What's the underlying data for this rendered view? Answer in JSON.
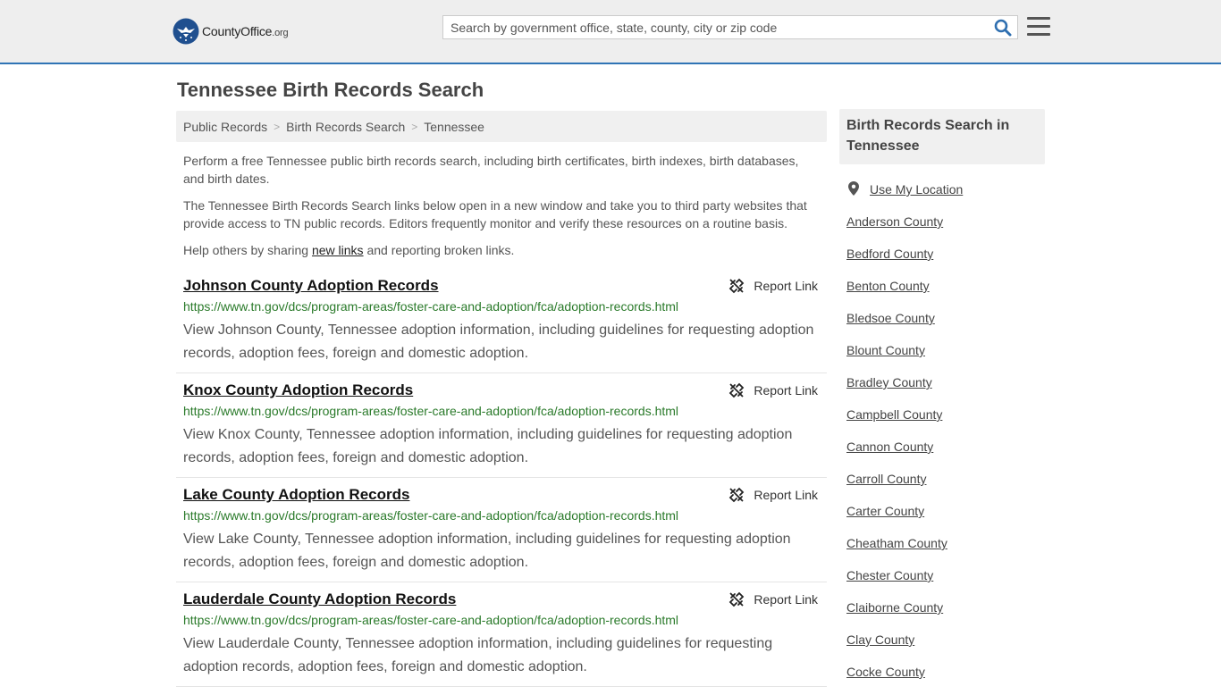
{
  "brand": {
    "name": "CountyOffice",
    "tld": ".org"
  },
  "search": {
    "placeholder": "Search by government office, state, county, city or zip code",
    "value": ""
  },
  "page": {
    "title": "Tennessee Birth Records Search"
  },
  "breadcrumb": {
    "items": [
      "Public Records",
      "Birth Records Search",
      "Tennessee"
    ]
  },
  "intro": {
    "p1": "Perform a free Tennessee public birth records search, including birth certificates, birth indexes, birth databases, and birth dates.",
    "p2": "The Tennessee Birth Records Search links below open in a new window and take you to third party websites that provide access to TN public records. Editors frequently monitor and verify these resources on a routine basis.",
    "p3_before": "Help others by sharing ",
    "p3_link": "new links",
    "p3_after": " and reporting broken links."
  },
  "report_label": "Report Link",
  "results": [
    {
      "title": "Johnson County Adoption Records",
      "url": "https://www.tn.gov/dcs/program-areas/foster-care-and-adoption/fca/adoption-records.html",
      "desc": "View Johnson County, Tennessee adoption information, including guidelines for requesting adoption records, adoption fees, foreign and domestic adoption."
    },
    {
      "title": "Knox County Adoption Records",
      "url": "https://www.tn.gov/dcs/program-areas/foster-care-and-adoption/fca/adoption-records.html",
      "desc": "View Knox County, Tennessee adoption information, including guidelines for requesting adoption records, adoption fees, foreign and domestic adoption."
    },
    {
      "title": "Lake County Adoption Records",
      "url": "https://www.tn.gov/dcs/program-areas/foster-care-and-adoption/fca/adoption-records.html",
      "desc": "View Lake County, Tennessee adoption information, including guidelines for requesting adoption records, adoption fees, foreign and domestic adoption."
    },
    {
      "title": "Lauderdale County Adoption Records",
      "url": "https://www.tn.gov/dcs/program-areas/foster-care-and-adoption/fca/adoption-records.html",
      "desc": "View Lauderdale County, Tennessee adoption information, including guidelines for requesting adoption records, adoption fees, foreign and domestic adoption."
    }
  ],
  "sidebar": {
    "heading": "Birth Records Search in Tennessee",
    "location_label": "Use My Location",
    "counties": [
      "Anderson County",
      "Bedford County",
      "Benton County",
      "Bledsoe County",
      "Blount County",
      "Bradley County",
      "Campbell County",
      "Cannon County",
      "Carroll County",
      "Carter County",
      "Cheatham County",
      "Chester County",
      "Claiborne County",
      "Clay County",
      "Cocke County"
    ]
  },
  "icons": {
    "logo": "eagle-seal-icon",
    "search": "search-icon",
    "menu": "hamburger-menu-icon",
    "report": "broken-link-icon",
    "location": "map-pin-icon"
  },
  "colors": {
    "accent": "#2f74b5",
    "url_green": "#2a7a2a",
    "header_bg": "#eeeeee"
  }
}
